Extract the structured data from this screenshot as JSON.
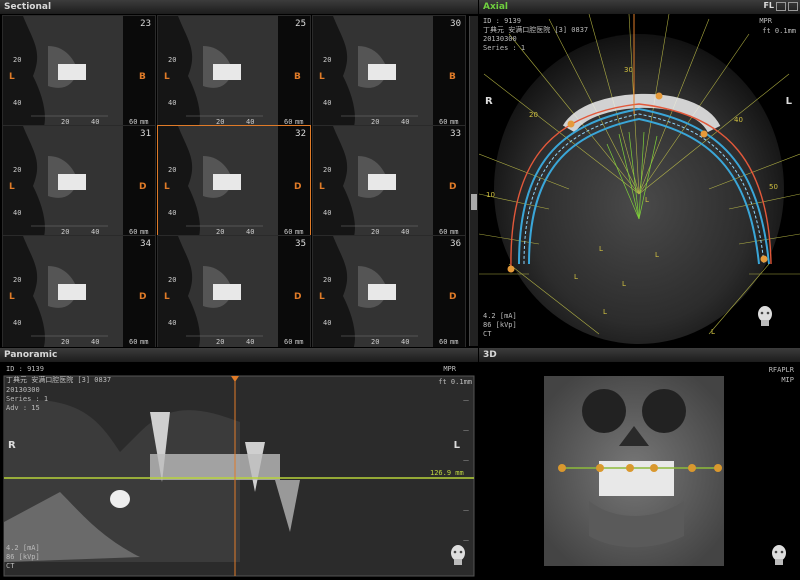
{
  "sectional": {
    "title": "Sectional",
    "cells": [
      {
        "num": "23",
        "left": "L",
        "right": "B"
      },
      {
        "num": "25",
        "left": "L",
        "right": "B"
      },
      {
        "num": "30",
        "left": "L",
        "right": "B"
      },
      {
        "num": "31",
        "left": "L",
        "right": "D"
      },
      {
        "num": "32",
        "left": "L",
        "right": "D",
        "active": true
      },
      {
        "num": "33",
        "left": "L",
        "right": "D"
      },
      {
        "num": "34",
        "left": "L",
        "right": "D"
      },
      {
        "num": "35",
        "left": "L",
        "right": "D"
      },
      {
        "num": "36",
        "left": "L",
        "right": "D"
      }
    ],
    "tick_20": "20",
    "tick_40": "40",
    "tick_60": "60",
    "tick_mm": "mm"
  },
  "axial": {
    "title": "Axial",
    "header_right": "FL",
    "id_line": "ID : 9139",
    "patient_line": "丁典元 安满口腔医院 [3] 0837",
    "date_line": "20130300",
    "series_line": "Series : 1",
    "mode": "MPR",
    "thickness": "ft 0.1mm",
    "label_r": "R",
    "label_l": "L",
    "ma": "4.2 [mA]",
    "kvp": "86 [kVp]",
    "ct": "CT",
    "rulers": [
      "30",
      "20",
      "10",
      "40",
      "50"
    ]
  },
  "panoramic": {
    "title": "Panoramic",
    "id_line": "ID : 9139",
    "patient_line": "丁典元 安满口腔医院 [3] 0837",
    "date_line": "20130300",
    "series_line": "Series : 1",
    "adv_line": "Adv : 15",
    "mode": "MPR",
    "thickness": "ft 0.1mm",
    "label_r": "R",
    "label_l": "L",
    "ma": "4.2 [mA]",
    "kvp": "86 [kVp]",
    "ct": "CT",
    "marker": "126.9 mm"
  },
  "view3d": {
    "title": "3D",
    "orient": "RFAPLR",
    "mode": "MIP"
  }
}
